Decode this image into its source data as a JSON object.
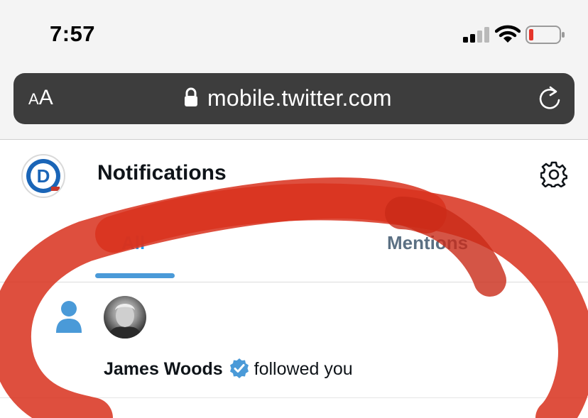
{
  "status_bar": {
    "time": "7:57",
    "signal_icon": "cellular-signal-icon",
    "wifi_icon": "wifi-icon",
    "battery_icon": "battery-low-icon",
    "battery_color": "#e5352b"
  },
  "browser": {
    "text_size_label_small": "A",
    "text_size_label_large": "A",
    "url": "mobile.twitter.com",
    "lock_icon": "lock-icon",
    "reload_icon": "reload-icon"
  },
  "header": {
    "title": "Notifications",
    "avatar_letter": "D",
    "settings_icon": "gear-icon"
  },
  "tabs": [
    {
      "label": "All",
      "active": true
    },
    {
      "label": "Mentions",
      "active": false
    }
  ],
  "notifications": [
    {
      "type_icon": "person-follow-icon",
      "user_name": "James Woods",
      "verified": true,
      "action_text": "followed you"
    }
  ],
  "colors": {
    "accent": "#1d9bf0",
    "annotation_red": "#d8321e"
  }
}
